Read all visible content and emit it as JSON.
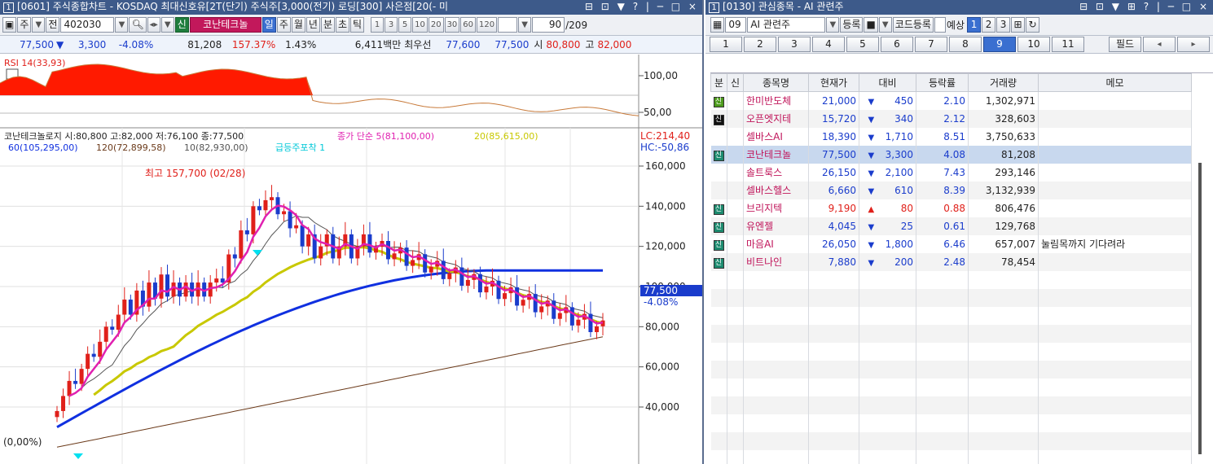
{
  "left_window": {
    "title_num": "1",
    "title": "[0601] 주식종합차트 - KOSDAQ 최대신호유[2T(단기) 주식주[3,000(전기) 로딩[300] 사은점[20(- 미",
    "title_controls": "⊟ ⊡ ▼ ? | ─ □ ×",
    "toolbar": {
      "market_label": "주",
      "prev_label": "전",
      "code": "402030",
      "stock_name": "코난테크놀",
      "period_buttons": [
        "일",
        "주",
        "월",
        "년",
        "분",
        "초",
        "틱"
      ],
      "active_period": "일",
      "interval_buttons": [
        "1",
        "3",
        "5",
        "10",
        "20",
        "30",
        "60",
        "120"
      ],
      "count_value": "90",
      "count_total": "/209"
    },
    "info": {
      "price": "77,500",
      "change": "3,300",
      "change_pct": "-4.08%",
      "volume": "81,208",
      "vol_ratio": "157.37%",
      "turnover": "1.43%",
      "amount": "6,411백만",
      "best_label": "최우선",
      "ask": "77,600",
      "bid": "77,500",
      "open_label": "시",
      "open": "80,800",
      "high_label": "고",
      "high": "82,000"
    },
    "rsi": {
      "label": "RSI 14(33,93)",
      "ticks": [
        "100,00",
        "50,00"
      ]
    },
    "main_chart": {
      "header1": "코난테크놀로지 시:80,800 고:82,000 저:76,100 종:77,500",
      "ma_label": "종가 단순 5(81,100,00)",
      "ma20_label": "20(85,615,00)",
      "header2_a": "60(105,295,00)",
      "header2_b": "120(72,899,58)",
      "header2_c": "10(82,930,00)",
      "header2_d": "급등주포착 1",
      "lc": "LC:214,40",
      "hc": "HC:-50,86",
      "max_label": "최고 157,700 (02/28)",
      "left_pct": "(0,00%)",
      "current_price": "77,500",
      "current_pct": "-4.08%",
      "y_ticks": [
        "160,000",
        "140,000",
        "120,000",
        "100,000",
        "80,000",
        "60,000",
        "40,000"
      ]
    }
  },
  "right_window": {
    "title_num": "1",
    "title": "[0130] 관심종목 - AI 관련주",
    "title_controls": "⊟ ⊡ ▼ ⊞ ? | ─ □ ×",
    "toolbar": {
      "group_no": "09",
      "group_name": "AI 관련주",
      "register": "등록",
      "code_register": "코드등록",
      "expect_label": "예상",
      "pages": [
        "1",
        "2",
        "3"
      ]
    },
    "tabs": [
      "1",
      "2",
      "3",
      "4",
      "5",
      "6",
      "7",
      "8",
      "9",
      "10",
      "11"
    ],
    "active_tab": "9",
    "field_button": "필드",
    "columns": [
      "분",
      "신",
      "종목명",
      "현재가",
      "대비",
      "등락률",
      "거래량",
      "메모"
    ],
    "rows": [
      {
        "flag": "신",
        "flag_type": "g",
        "name": "한미반도체",
        "price": "21,000",
        "dir": "down",
        "diff": "450",
        "pct": "2.10",
        "volume": "1,302,971",
        "memo": ""
      },
      {
        "flag": "신",
        "flag_type": "k",
        "name": "오픈엣지테",
        "price": "15,720",
        "dir": "down",
        "diff": "340",
        "pct": "2.12",
        "volume": "328,603",
        "memo": ""
      },
      {
        "flag": "",
        "flag_type": "",
        "name": "셀바스AI",
        "price": "18,390",
        "dir": "down",
        "diff": "1,710",
        "pct": "8.51",
        "volume": "3,750,633",
        "memo": ""
      },
      {
        "flag": "신",
        "flag_type": "t",
        "name": "코난테크놀",
        "price": "77,500",
        "dir": "down",
        "diff": "3,300",
        "pct": "4.08",
        "volume": "81,208",
        "memo": ""
      },
      {
        "flag": "",
        "flag_type": "",
        "name": "솔트룩스",
        "price": "26,150",
        "dir": "down",
        "diff": "2,100",
        "pct": "7.43",
        "volume": "293,146",
        "memo": ""
      },
      {
        "flag": "",
        "flag_type": "",
        "name": "셀바스헬스",
        "price": "6,660",
        "dir": "down",
        "diff": "610",
        "pct": "8.39",
        "volume": "3,132,939",
        "memo": ""
      },
      {
        "flag": "신",
        "flag_type": "t",
        "name": "브리지텍",
        "price": "9,190",
        "dir": "up",
        "diff": "80",
        "pct": "0.88",
        "volume": "806,476",
        "memo": ""
      },
      {
        "flag": "신",
        "flag_type": "t",
        "name": "유엔젤",
        "price": "4,045",
        "dir": "down",
        "diff": "25",
        "pct": "0.61",
        "volume": "129,768",
        "memo": ""
      },
      {
        "flag": "신",
        "flag_type": "t",
        "name": "마음AI",
        "price": "26,050",
        "dir": "down",
        "diff": "1,800",
        "pct": "6.46",
        "volume": "657,007",
        "memo": "눌림목까지 기다려라"
      },
      {
        "flag": "신",
        "flag_type": "t",
        "name": "비트나인",
        "price": "7,880",
        "dir": "down",
        "diff": "200",
        "pct": "2.48",
        "volume": "78,454",
        "memo": ""
      }
    ]
  },
  "colors": {
    "up": "#e0201a",
    "down": "#1a3ccc",
    "ma5": "#e020b0",
    "ma20": "#c8c800",
    "ma60": "#1030e0",
    "ma120": "#6b3a1a",
    "ma10": "#555555",
    "titlebar": "#3d5a8a"
  }
}
